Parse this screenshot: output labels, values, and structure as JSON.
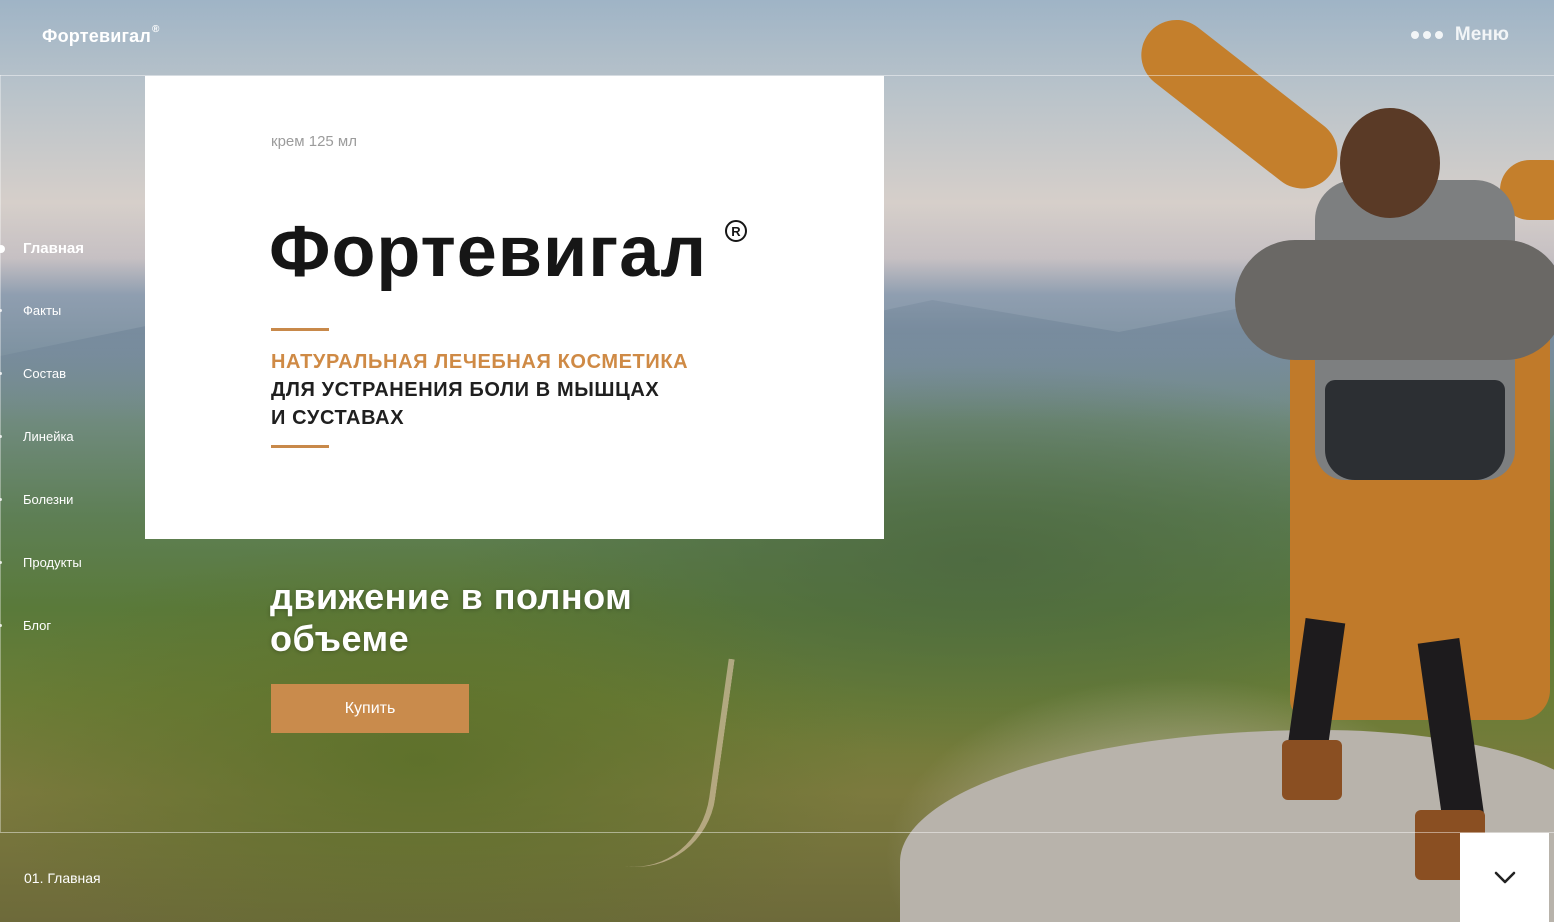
{
  "header": {
    "logo_text": "Фортевигал",
    "logo_mark": "®",
    "menu_label": "Меню",
    "menu_icon": "dots-icon"
  },
  "sidenav": {
    "items": [
      {
        "label": "Главная",
        "active": true
      },
      {
        "label": "Факты",
        "active": false
      },
      {
        "label": "Состав",
        "active": false
      },
      {
        "label": "Линейка",
        "active": false
      },
      {
        "label": "Болезни",
        "active": false
      },
      {
        "label": "Продукты",
        "active": false
      },
      {
        "label": "Блог",
        "active": false
      }
    ]
  },
  "card": {
    "volume": "крем 125 мл",
    "brand": "Фортевигал",
    "registered": "R",
    "subtitle_accent": "НАТУРАЛЬНАЯ ЛЕЧЕБНАЯ КОСМЕТИКА",
    "subtitle_line2": "ДЛЯ УСТРАНЕНИЯ БОЛИ В МЫШЦАХ",
    "subtitle_line3": "И СУСТАВАХ"
  },
  "hero": {
    "slogan_line1": "движение в полном",
    "slogan_line2": "объеме",
    "buy_label": "Купить"
  },
  "footer": {
    "section_indicator": "01. Главная",
    "scroll_icon": "chevron-down-icon"
  },
  "colors": {
    "accent": "#c98b4c",
    "card_bg": "#ffffff",
    "text_dark": "#161616"
  }
}
